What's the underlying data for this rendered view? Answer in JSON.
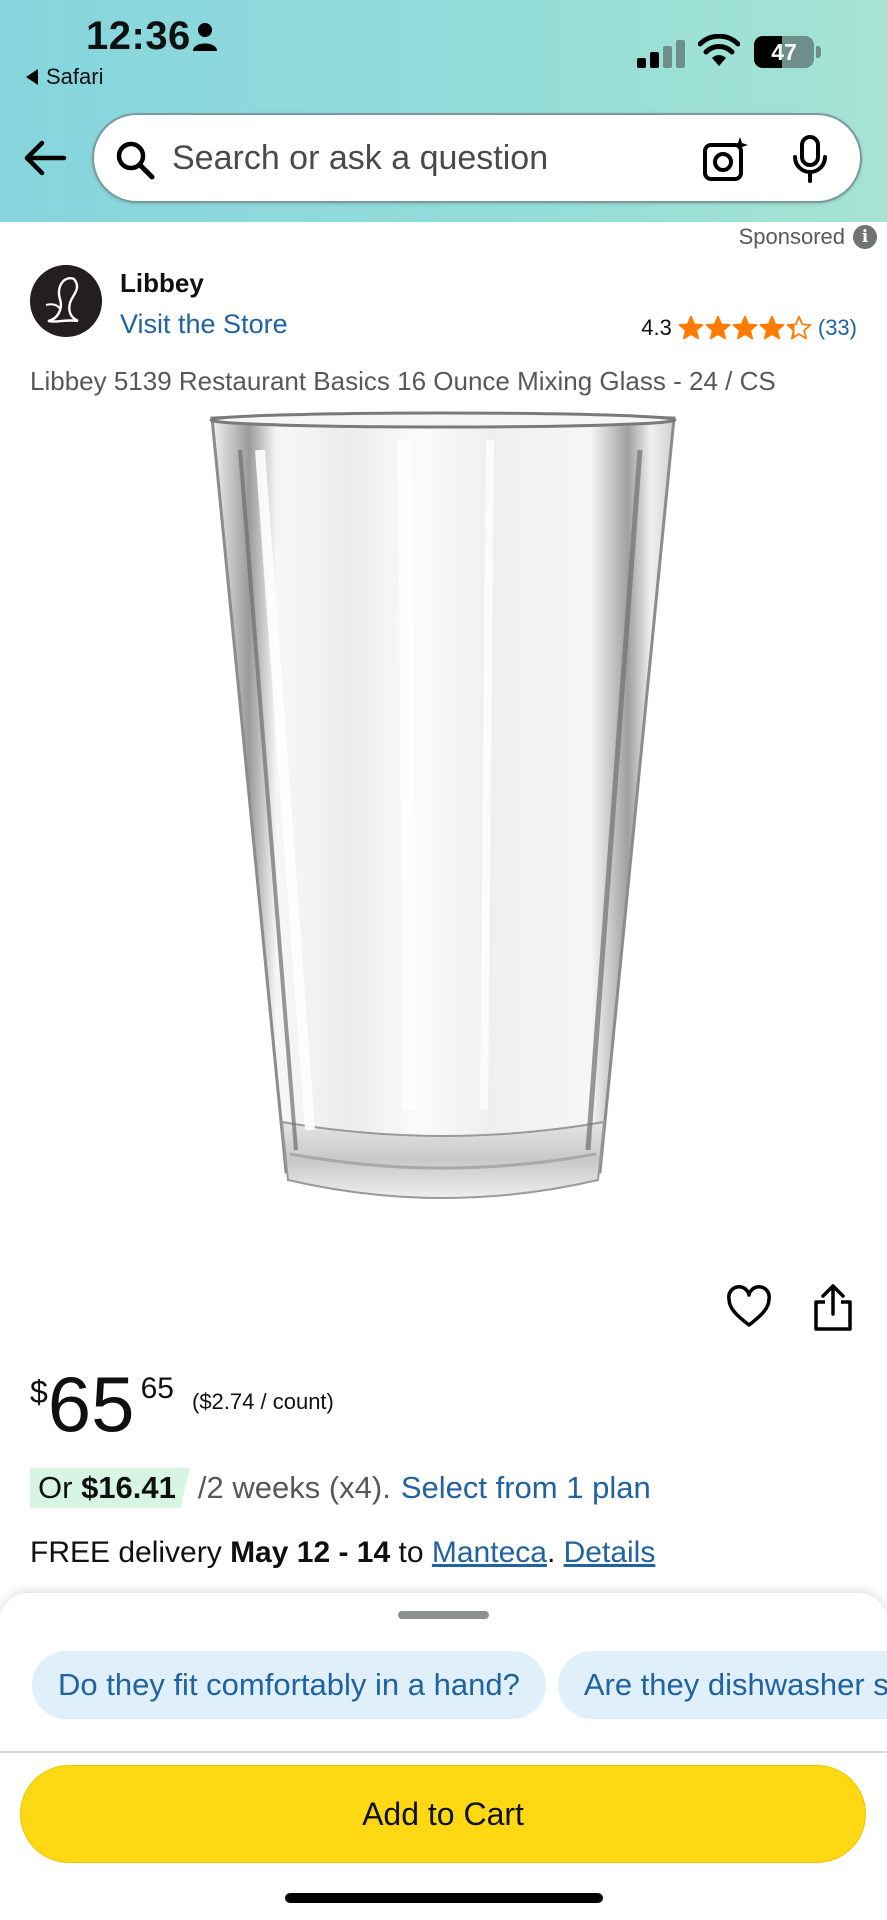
{
  "status_bar": {
    "time": "12:36",
    "back_app": "Safari",
    "battery": "47",
    "battery_level": 0.47
  },
  "search": {
    "placeholder": "Search or ask a question"
  },
  "sponsored": {
    "label": "Sponsored",
    "info_glyph": "i"
  },
  "brand": {
    "name": "Libbey",
    "visit_store": "Visit the Store",
    "logo_letter": "L"
  },
  "rating": {
    "score": "4.3",
    "stars": 4.3,
    "count": "(33)",
    "star_color": "#ff7a00"
  },
  "product": {
    "title": "Libbey 5139 Restaurant Basics 16 Ounce Mixing Glass - 24 / CS"
  },
  "price": {
    "symbol": "$",
    "whole": "65",
    "fraction": "65",
    "unit": "($2.74 / count)"
  },
  "installment": {
    "or": "Or",
    "amount": "$16.41",
    "terms": "/2 weeks (x4).",
    "plan_link": "Select from 1 plan"
  },
  "delivery": {
    "free": "FREE delivery",
    "dates": "May 12 - 14",
    "to": "to",
    "city": "Manteca",
    "period": ".",
    "details": "Details"
  },
  "questions": [
    "Do they fit comfortably in a hand?",
    "Are they dishwasher safe?"
  ],
  "cart": {
    "label": "Add to Cart",
    "color": "#ffd814"
  },
  "icons": {
    "back": "arrow-left-icon",
    "search": "magnifier-icon",
    "camera": "camera-sparkle-icon",
    "mic": "microphone-icon",
    "wishlist": "heart-icon",
    "share": "share-icon"
  }
}
